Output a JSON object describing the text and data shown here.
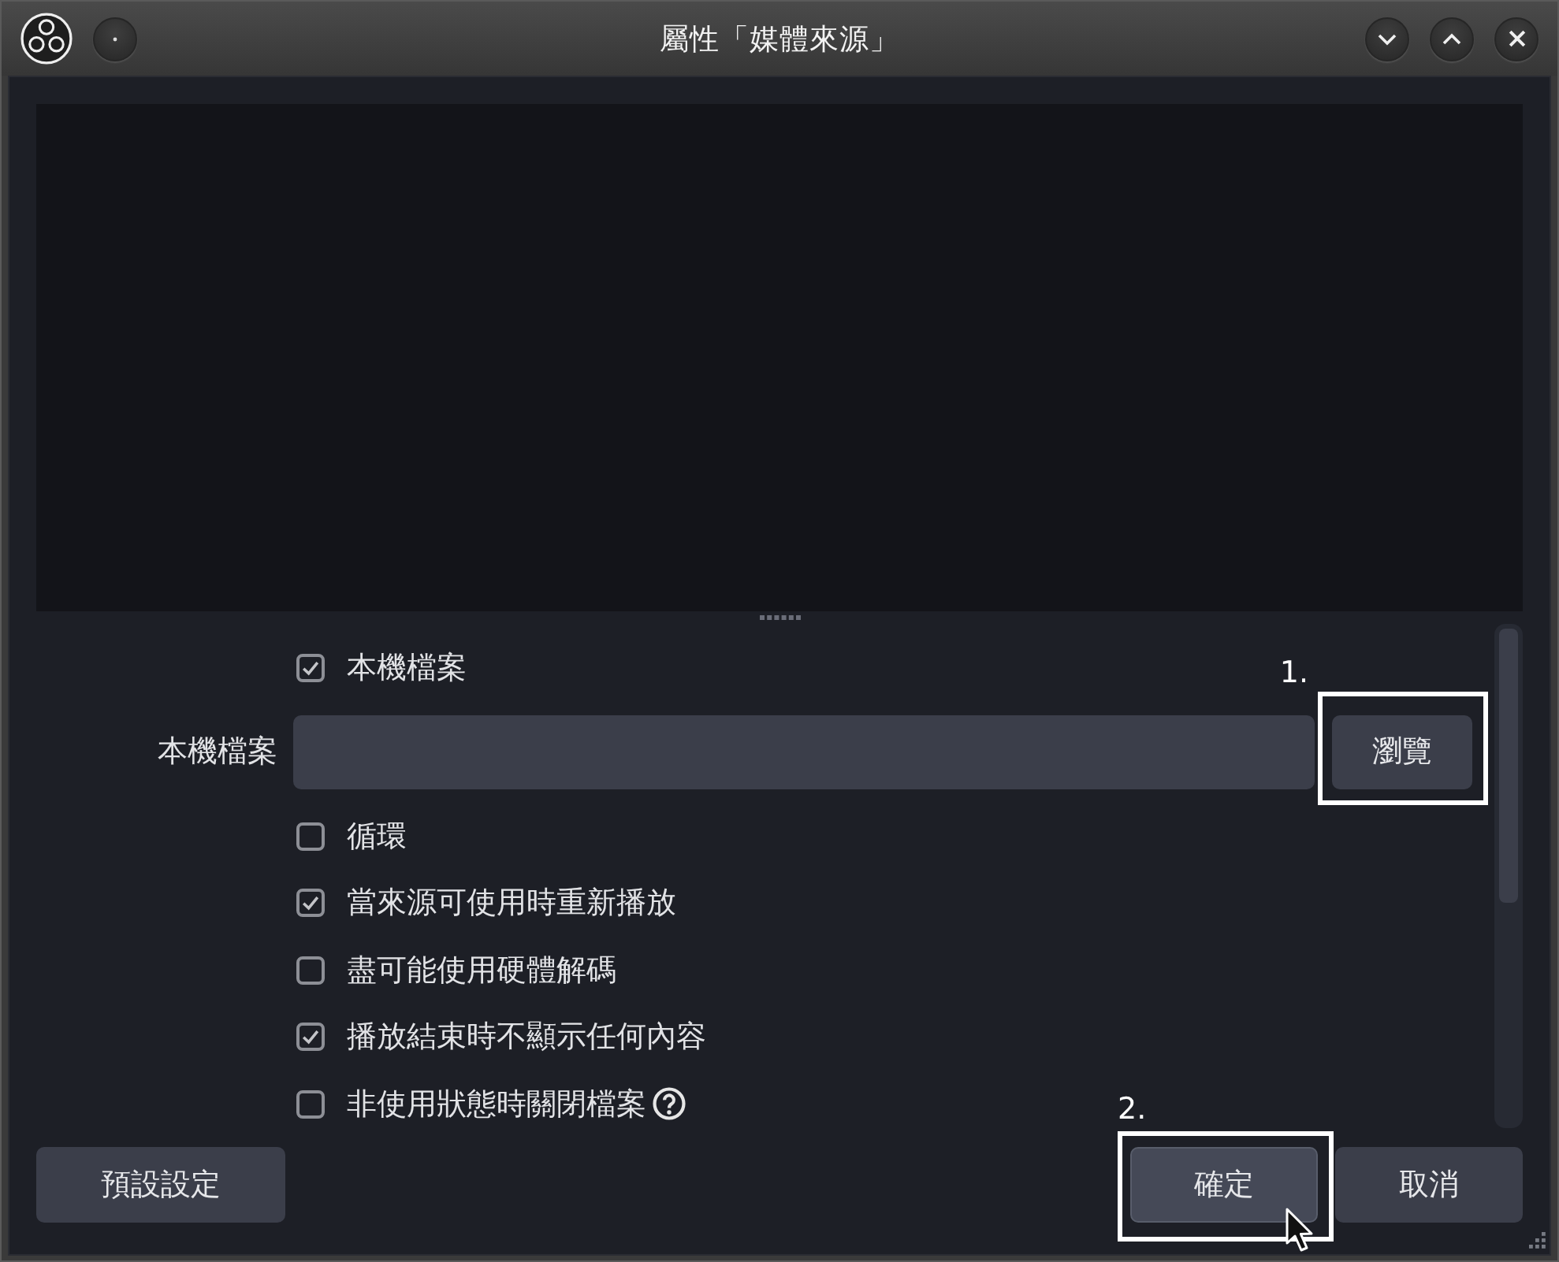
{
  "window": {
    "title": "屬性「媒體來源」"
  },
  "properties": [
    {
      "kind": "checkbox",
      "label": "本機檔案",
      "checked": true
    },
    {
      "kind": "file",
      "label": "本機檔案",
      "button": {
        "label": "瀏覽",
        "annotation": "1."
      }
    },
    {
      "kind": "checkbox",
      "label": "循環",
      "checked": false
    },
    {
      "kind": "checkbox",
      "label": "當來源可使用時重新播放",
      "checked": true
    },
    {
      "kind": "checkbox",
      "label": "盡可能使用硬體解碼",
      "checked": false
    },
    {
      "kind": "checkbox",
      "label": "播放結束時不顯示任何內容",
      "checked": true
    },
    {
      "kind": "checkbox",
      "label": "非使用狀態時關閉檔案",
      "checked": false,
      "help": true
    }
  ],
  "footer": {
    "left": [
      {
        "label": "預設設定",
        "hovered": false
      }
    ],
    "right": [
      {
        "label": "確定",
        "hovered": true,
        "annotation": "2."
      },
      {
        "label": "取消",
        "hovered": false
      }
    ]
  }
}
